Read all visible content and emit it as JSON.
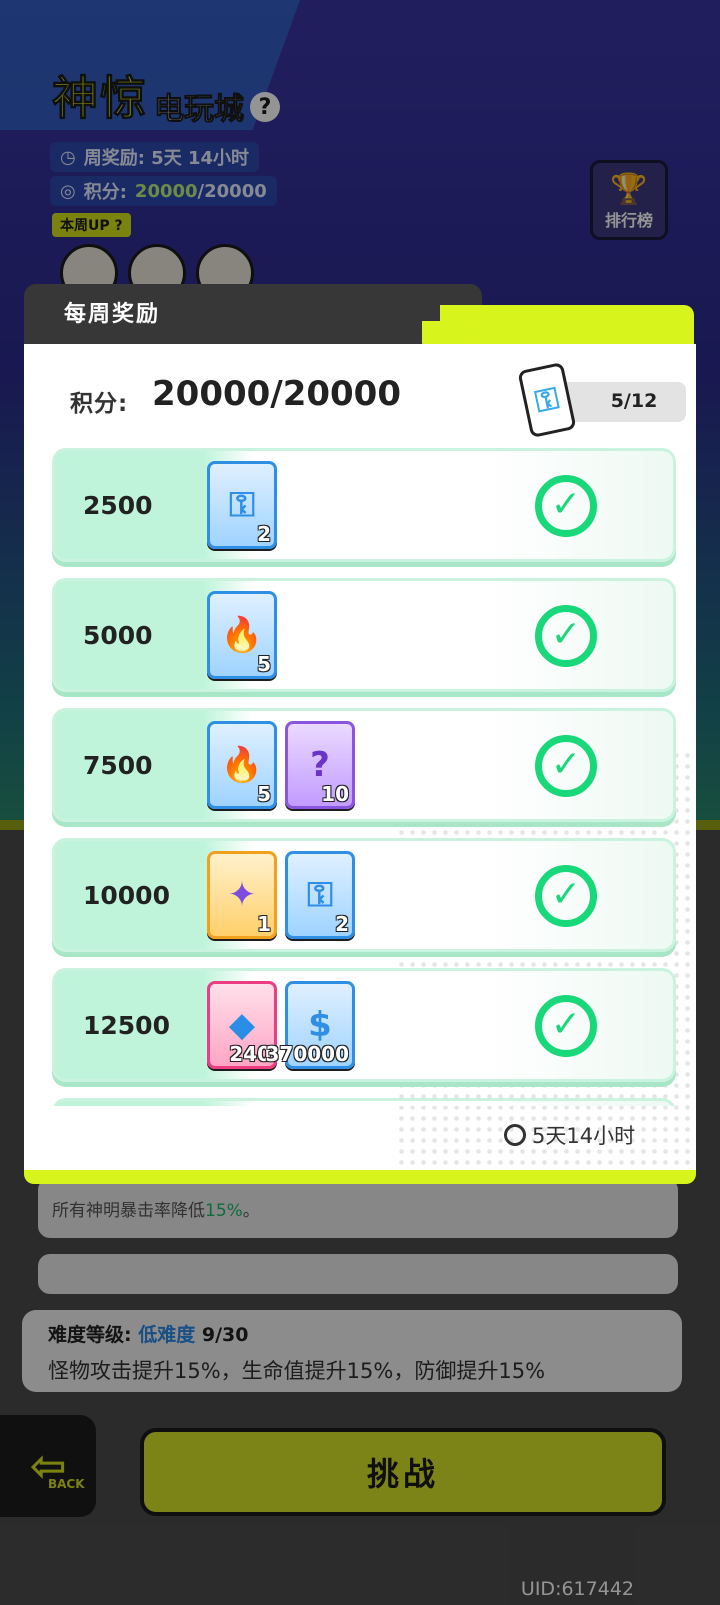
{
  "hud": {
    "title_big": "神惊",
    "title_small": "电玩城",
    "help_icon": "?",
    "weekly_reward_label": "周奖励: 5天 14小时",
    "points_label": "积分:",
    "points_current": "20000",
    "points_total": "/20000",
    "up_badge": "本周UP ?",
    "leaderboard_label": "排行榜"
  },
  "modal": {
    "title": "每周奖励",
    "score_label": "积分:",
    "score_value": "20000/20000",
    "key_count": "5/12",
    "timer": "5天14小时",
    "rows": [
      {
        "score": "2500",
        "items": [
          {
            "icon": "key-icon",
            "glyph": "⚿",
            "qty": "2"
          }
        ]
      },
      {
        "score": "5000",
        "items": [
          {
            "icon": "blue-flame-icon",
            "glyph": "🔥",
            "qty": "5"
          }
        ]
      },
      {
        "score": "7500",
        "items": [
          {
            "icon": "blue-flame-icon",
            "glyph": "🔥",
            "qty": "5"
          },
          {
            "icon": "mystery-fragment-icon",
            "glyph": "?",
            "qty": "10"
          }
        ]
      },
      {
        "score": "10000",
        "items": [
          {
            "icon": "ticket-icon",
            "glyph": "✦",
            "qty": "1"
          },
          {
            "icon": "key-icon",
            "glyph": "⚿",
            "qty": "2"
          }
        ]
      },
      {
        "score": "12500",
        "items": [
          {
            "icon": "diamond-icon",
            "glyph": "◆",
            "qty": "240"
          },
          {
            "icon": "cash-icon",
            "glyph": "$",
            "qty": "370000"
          }
        ]
      }
    ],
    "check_mark": "✓"
  },
  "background": {
    "skill_text_prefix": "所有神明暴击率降低",
    "skill_text_value": "15%",
    "skill_text_suffix": "。",
    "difficulty_label": "难度等级:",
    "difficulty_value": "低难度",
    "difficulty_progress": "9/30",
    "difficulty_desc": "怪物攻击提升15%，生命值提升15%，防御提升15%",
    "back_label": "BACK",
    "challenge_label": "挑战",
    "uid": "UID:617442"
  },
  "colors": {
    "lime": "#d8f41d",
    "mint": "#bff4da",
    "check_green": "#19d87a",
    "accent_blue": "#2f8fe5"
  }
}
